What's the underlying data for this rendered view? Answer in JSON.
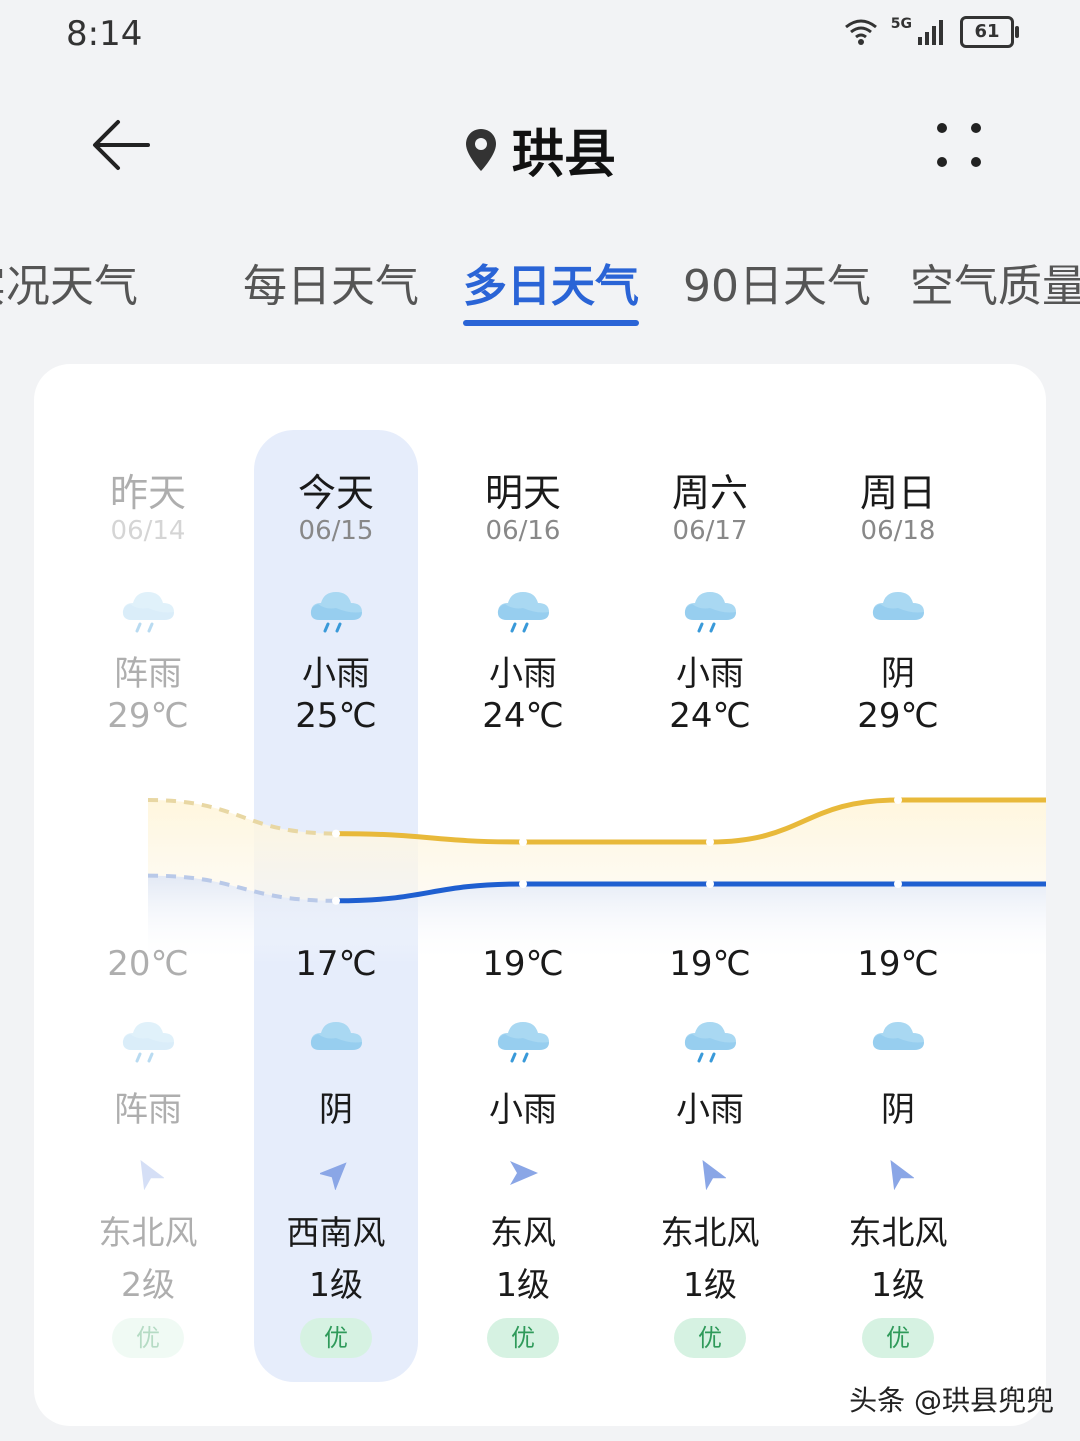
{
  "status_bar": {
    "time": "8:14",
    "network": "5G",
    "battery": "61"
  },
  "header": {
    "title": "珙县"
  },
  "tabs": [
    {
      "label": "实况天气"
    },
    {
      "label": "每日天气"
    },
    {
      "label": "多日天气"
    },
    {
      "label": "90日天气"
    },
    {
      "label": "空气质量"
    }
  ],
  "active_tab": "多日天气",
  "forecast": [
    {
      "day": "昨天",
      "date": "06/14",
      "day_cond": "阵雨",
      "day_icon": "shower-icon",
      "high": "29℃",
      "low": "20℃",
      "night_cond": "阵雨",
      "night_icon": "shower-icon",
      "wind_dir": "东北风",
      "wind_level": "2级",
      "aqi": "优"
    },
    {
      "day": "今天",
      "date": "06/15",
      "day_cond": "小雨",
      "day_icon": "light-rain-icon",
      "high": "25℃",
      "low": "17℃",
      "night_cond": "阴",
      "night_icon": "overcast-icon",
      "wind_dir": "西南风",
      "wind_level": "1级",
      "aqi": "优"
    },
    {
      "day": "明天",
      "date": "06/16",
      "day_cond": "小雨",
      "day_icon": "light-rain-icon",
      "high": "24℃",
      "low": "19℃",
      "night_cond": "小雨",
      "night_icon": "light-rain-icon",
      "wind_dir": "东风",
      "wind_level": "1级",
      "aqi": "优"
    },
    {
      "day": "周六",
      "date": "06/17",
      "day_cond": "小雨",
      "day_icon": "light-rain-icon",
      "high": "24℃",
      "low": "19℃",
      "night_cond": "小雨",
      "night_icon": "light-rain-icon",
      "wind_dir": "东北风",
      "wind_level": "1级",
      "aqi": "优"
    },
    {
      "day": "周日",
      "date": "06/18",
      "day_cond": "阴",
      "day_icon": "overcast-icon",
      "high": "29℃",
      "low": "19℃",
      "night_cond": "阴",
      "night_icon": "overcast-icon",
      "wind_dir": "东北风",
      "wind_level": "1级",
      "aqi": "优"
    }
  ],
  "colors": {
    "accent": "#2a64d6",
    "high_line": "#e8b93a",
    "low_line": "#1f5fd0",
    "aqi_good": "#2f9a5a"
  },
  "watermark": "头条 @珙县兜兜"
}
